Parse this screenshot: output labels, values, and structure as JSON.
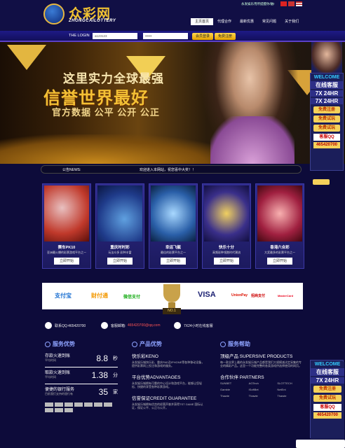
{
  "header": {
    "logo_cn": "众彩网",
    "logo_en": "ZHONGCAILOTTERY",
    "top_link": "永发娱乐用所提醒你/触!",
    "nav": [
      "主页首页",
      "代理合作",
      "最新优惠",
      "常见问题",
      "关于我们"
    ]
  },
  "login": {
    "label": "THE LOGIN",
    "user_value": "a123123",
    "pass_value": "••••••",
    "login_btn": "会员登录",
    "register_btn": "免费注册"
  },
  "banner": {
    "line1": "这里实力全球最强",
    "line2": "信誉世界最好",
    "line3": "官方数据 公平 公开 公正"
  },
  "news": {
    "label": "公告NEWS:",
    "text": "欢迎进入本网站，祝您喜中大奖！！"
  },
  "sidebar": {
    "welcome": "WELCOME",
    "online": "在线客服",
    "hours1": "7X 24HR",
    "hours2": "7X 24HR",
    "btn1": "免费注册",
    "btn2": "免费试玩",
    "btn3": "免费试玩",
    "qq": "客服QQ",
    "qq_num": "465420700"
  },
  "games": [
    {
      "name": "赛车PK10",
      "desc": "亚洲最火爆的彩票游戏平台之一",
      "btn": "立即开始",
      "color": "#c0392b"
    },
    {
      "name": "重庆时时彩",
      "desc": "玩法众多 彩种丰富",
      "btn": "立即开始",
      "color": "#1f3b8a"
    },
    {
      "name": "幸运飞艇",
      "desc": "最佳的彩票平台之一",
      "btn": "立即开始",
      "color": "#2a5fa8"
    },
    {
      "name": "快乐十分",
      "desc": "高频彩种领跑时代潮流",
      "btn": "立即开始",
      "color": "#3a2f8a"
    },
    {
      "name": "香港六合彩",
      "desc": "大奖最多的彩票平台之一",
      "btn": "立即开始",
      "color": "#a02040"
    }
  ],
  "payments": [
    "支付宝",
    "财付通",
    "微信支付",
    "VISA",
    "UnionPay",
    "招商支付",
    "MasterCard"
  ],
  "trophy_label": "NO.1",
  "contact": {
    "qq": "联系QQ:465420700",
    "email_label": "客服邮箱:",
    "email": "465420700@qq.com",
    "service": "7X24小时在线客服"
  },
  "footer": {
    "service_title": "服务优势",
    "deposit_title": "存款火速到账",
    "deposit_sub": "平均时间",
    "deposit_val": "8.8",
    "deposit_unit": "秒",
    "withdraw_title": "取款火速到账",
    "withdraw_sub": "平均时间",
    "withdraw_val": "1.38",
    "withdraw_unit": "分",
    "bank_title": "便捷的银行服务",
    "bank_sub": "目前我们支持的银行有",
    "bank_val": "35",
    "bank_unit": "家",
    "product_title": "产品优势",
    "p1_t": "快乐彩KENO",
    "p1_d": "永发娱乐城快乐彩、重庆PAD及IPHONE等各种移动设备，提供彩票网上投注和游戏的服务。",
    "p2_t": "平台优势ADVANTAGES",
    "p2_d": "永发娱乐城拥有可靠的中心设计和游戏平台，能够让您轻松、快捷的享受各种彩票游戏。",
    "p3_t": "信誉保证CREDIT GUARANTEE",
    "p3_d": "永发娱乐城拥有优良的经营声誉并获得TST GAME 国际认证，保证公平、公正与公开。",
    "help_title": "服务帮助",
    "sup_t": "顶级产品 SUPERSIVE PRODUCTS",
    "sup_d": "每一款业界上最的永发娱乐城产品都是我们大规模减试定采集的专业的精彩产品。这里一个功能完整的各类游戏供选择使用的网页。",
    "partners_t": "合作伙伴 PARTNERS",
    "partners": [
      "SUNBET",
      "AGTech",
      "SLOTTECH",
      "Gamble",
      "iSoftBet",
      "NetEnt",
      "Thawte",
      "Thawte",
      "Thawte"
    ]
  }
}
